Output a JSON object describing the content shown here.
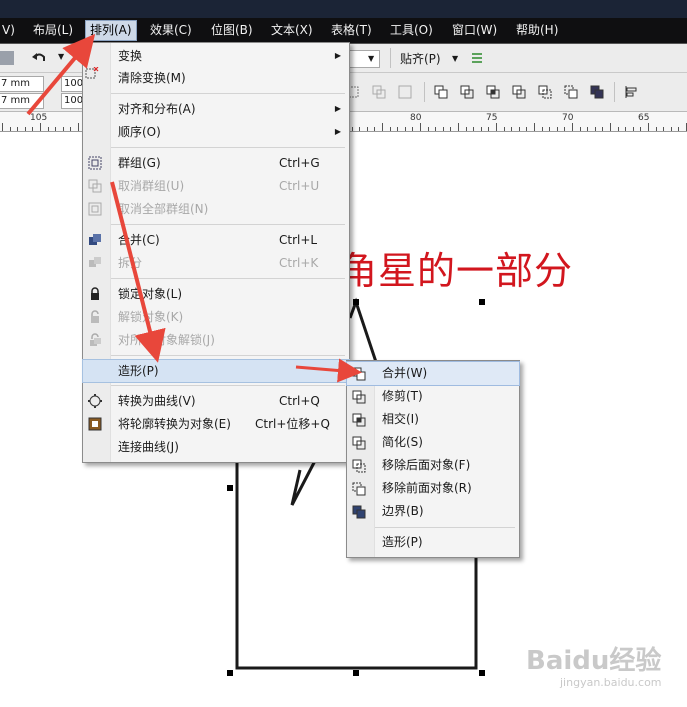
{
  "menubar": {
    "items": [
      {
        "label": "V)"
      },
      {
        "label": "布局(L)"
      },
      {
        "label": "排列(A)"
      },
      {
        "label": "效果(C)"
      },
      {
        "label": "位图(B)"
      },
      {
        "label": "文本(X)"
      },
      {
        "label": "表格(T)"
      },
      {
        "label": "工具(O)"
      },
      {
        "label": "窗口(W)"
      },
      {
        "label": "帮助(H)"
      }
    ],
    "active_label": "排列(A)"
  },
  "toolbar": {
    "snap_label": "贴齐(P)",
    "width_value": "7 mm",
    "height_value": "7 mm",
    "scale_x": "100",
    "scale_y": "100"
  },
  "ruler": {
    "labels": [
      "105",
      "80",
      "75",
      "70",
      "65"
    ]
  },
  "canvas": {
    "heading": "五角星的一部分"
  },
  "arrange_menu": {
    "items": [
      {
        "label": "变换",
        "shortcut": "",
        "submenu": true,
        "disabled": false
      },
      {
        "label": "清除变换(M)",
        "shortcut": "",
        "submenu": false,
        "disabled": false
      },
      {
        "label": "对齐和分布(A)",
        "shortcut": "",
        "submenu": true,
        "disabled": false
      },
      {
        "label": "顺序(O)",
        "shortcut": "",
        "submenu": true,
        "disabled": false
      },
      {
        "label": "群组(G)",
        "shortcut": "Ctrl+G",
        "submenu": false,
        "disabled": false
      },
      {
        "label": "取消群组(U)",
        "shortcut": "Ctrl+U",
        "submenu": false,
        "disabled": true
      },
      {
        "label": "取消全部群组(N)",
        "shortcut": "",
        "submenu": false,
        "disabled": true
      },
      {
        "label": "合并(C)",
        "shortcut": "Ctrl+L",
        "submenu": false,
        "disabled": false
      },
      {
        "label": "拆分",
        "shortcut": "Ctrl+K",
        "submenu": false,
        "disabled": true
      },
      {
        "label": "锁定对象(L)",
        "shortcut": "",
        "submenu": false,
        "disabled": false
      },
      {
        "label": "解锁对象(K)",
        "shortcut": "",
        "submenu": false,
        "disabled": true
      },
      {
        "label": "对所有对象解锁(J)",
        "shortcut": "",
        "submenu": false,
        "disabled": true
      },
      {
        "label": "造形(P)",
        "shortcut": "",
        "submenu": true,
        "disabled": false,
        "highlight": true
      },
      {
        "label": "转换为曲线(V)",
        "shortcut": "Ctrl+Q",
        "submenu": false,
        "disabled": false
      },
      {
        "label": "将轮廓转换为对象(E)",
        "shortcut": "Ctrl+位移+Q",
        "submenu": false,
        "disabled": false
      },
      {
        "label": "连接曲线(J)",
        "shortcut": "",
        "submenu": false,
        "disabled": false
      }
    ]
  },
  "shaping_menu": {
    "items": [
      {
        "label": "合并(W)",
        "icon": "weld-icon",
        "highlight": true
      },
      {
        "label": "修剪(T)",
        "icon": "trim-icon"
      },
      {
        "label": "相交(I)",
        "icon": "intersect-icon"
      },
      {
        "label": "简化(S)",
        "icon": "simplify-icon"
      },
      {
        "label": "移除后面对象(F)",
        "icon": "back-minus-front-icon"
      },
      {
        "label": "移除前面对象(R)",
        "icon": "front-minus-back-icon"
      },
      {
        "label": "边界(B)",
        "icon": "boundary-icon"
      },
      {
        "label": "造形(P)",
        "icon": ""
      }
    ]
  },
  "watermark": {
    "text": "Baidu经验",
    "url_text": "jingyan.baidu.com"
  },
  "colors": {
    "annotation_arrow": "#e8473b",
    "heading_red": "#d2161e",
    "menu_highlight": "#d5e3f3"
  }
}
